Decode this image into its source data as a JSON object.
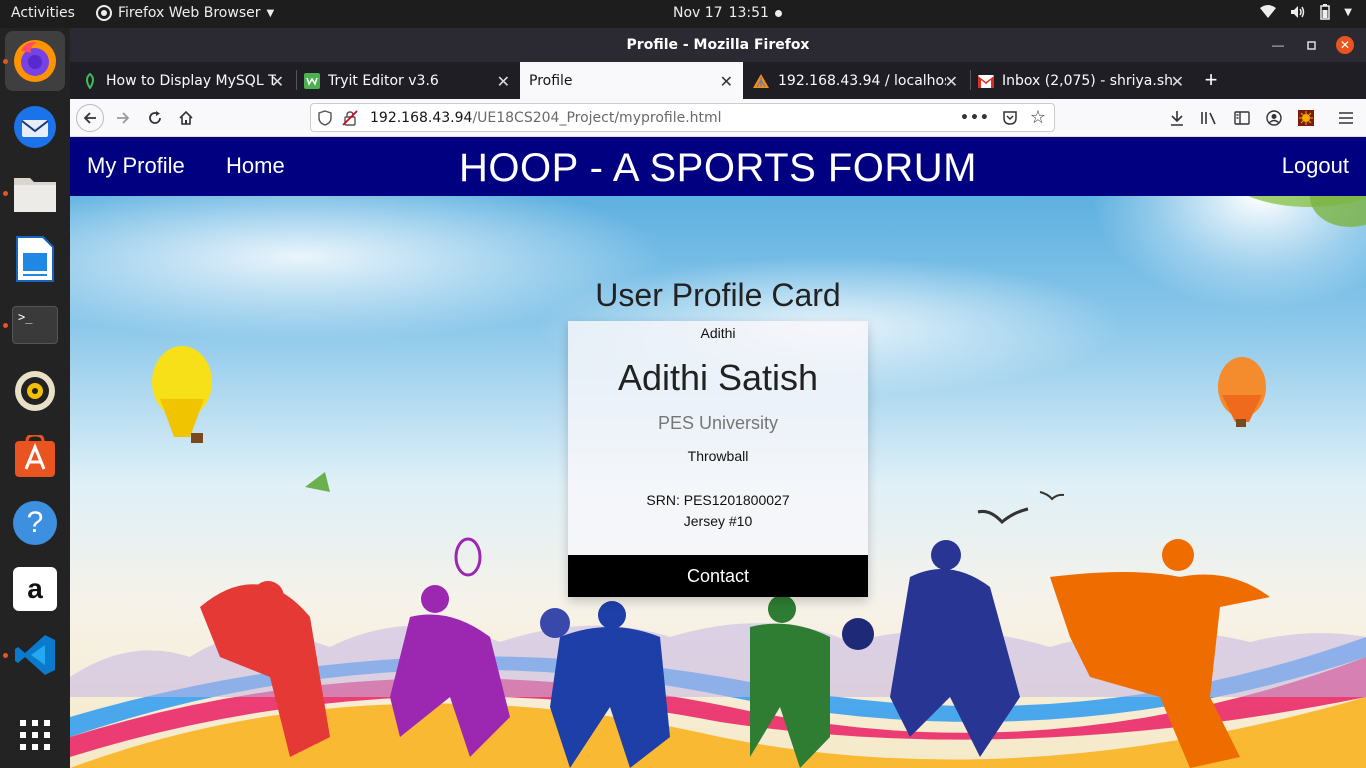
{
  "topbar": {
    "activities": "Activities",
    "app_name": "Firefox Web Browser",
    "date": "Nov 17",
    "time": "13:51"
  },
  "dock": {
    "items": [
      "firefox-icon",
      "thunderbird-icon",
      "files-icon",
      "writer-icon",
      "terminal-icon",
      "rhythmbox-icon",
      "software-center-icon",
      "help-icon",
      "amazon-icon",
      "vscode-icon",
      "show-apps-icon"
    ],
    "terminal_glyph": ">_",
    "help_glyph": "?",
    "amazon_glyph": "a"
  },
  "window": {
    "title": "Profile - Mozilla Firefox"
  },
  "tabs": [
    {
      "label": "How to Display MySQL T",
      "icon": "tutorial-icon"
    },
    {
      "label": "Tryit Editor v3.6",
      "icon": "w3schools-icon"
    },
    {
      "label": "Profile",
      "icon": "",
      "selected": true
    },
    {
      "label": "192.168.43.94 / localhos",
      "icon": "phpmyadmin-icon"
    },
    {
      "label": "Inbox (2,075) - shriya.sha",
      "icon": "gmail-icon"
    }
  ],
  "urlbar": {
    "host": "192.168.43.94",
    "path": "/UE18CS204_Project/myprofile.html"
  },
  "site": {
    "nav_profile": "My Profile",
    "nav_home": "Home",
    "brand": "HOOP - A SPORTS FORUM",
    "nav_logout": "Logout",
    "nav_color": "#000080"
  },
  "profile": {
    "heading": "User Profile Card",
    "image_alt": "Adithi",
    "name": "Adithi Satish",
    "university": "PES University",
    "sport": "Throwball",
    "srn": "SRN: PES1201800027",
    "jersey": "Jersey #10",
    "contact_label": "Contact"
  }
}
